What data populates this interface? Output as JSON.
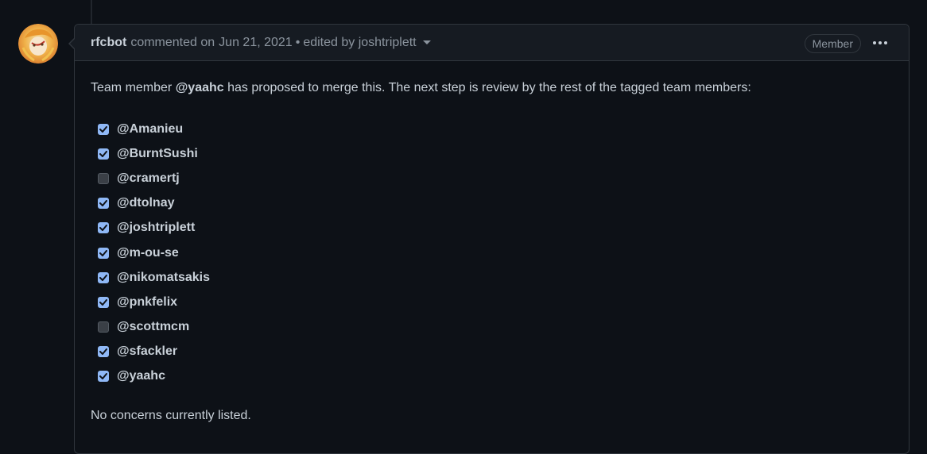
{
  "comment": {
    "author": "rfcbot",
    "action": "commented on",
    "date": "Jun 21, 2021",
    "separator": "•",
    "edited_text": "edited by joshtriplett",
    "badge": "Member"
  },
  "body": {
    "intro_prefix": "Team member ",
    "intro_mention": "@yaahc",
    "intro_suffix": " has proposed to merge this. The next step is review by the rest of the tagged team members:",
    "members": [
      {
        "name": "@Amanieu",
        "checked": true
      },
      {
        "name": "@BurntSushi",
        "checked": true
      },
      {
        "name": "@cramertj",
        "checked": false
      },
      {
        "name": "@dtolnay",
        "checked": true
      },
      {
        "name": "@joshtriplett",
        "checked": true
      },
      {
        "name": "@m-ou-se",
        "checked": true
      },
      {
        "name": "@nikomatsakis",
        "checked": true
      },
      {
        "name": "@pnkfelix",
        "checked": true
      },
      {
        "name": "@scottmcm",
        "checked": false
      },
      {
        "name": "@sfackler",
        "checked": true
      },
      {
        "name": "@yaahc",
        "checked": true
      }
    ],
    "concerns": "No concerns currently listed."
  },
  "colors": {
    "background": "#0d1117",
    "header_bg": "#161b22",
    "border": "#30363d",
    "text": "#c9d1d9",
    "muted": "#8b949e",
    "checkbox_checked": "#8fb8f6",
    "checkbox_unchecked": "#3a3f46"
  }
}
